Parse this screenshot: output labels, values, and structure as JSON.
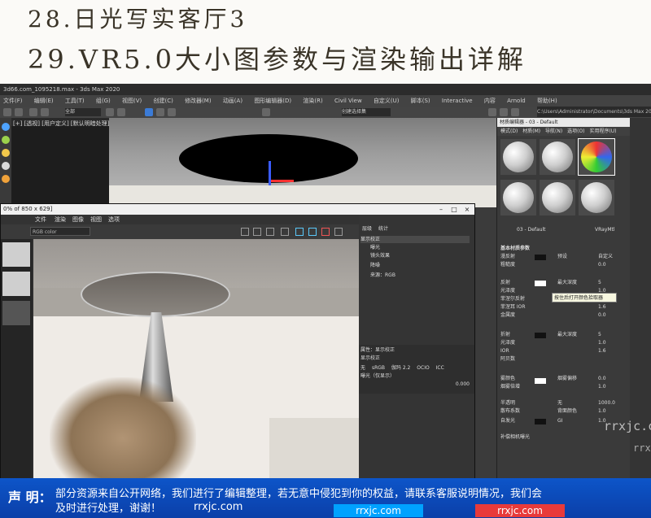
{
  "header": {
    "line1": "28.日光写实客厅3",
    "line2": "29.VR5.0大小图参数与渲染输出详解"
  },
  "max": {
    "title": "3d66.com_1095218.max - 3ds Max 2020",
    "menu": [
      "文件(F)",
      "编辑(E)",
      "工具(T)",
      "组(G)",
      "视图(V)",
      "创建(C)",
      "修改器(M)",
      "动画(A)",
      "图形编辑器(D)",
      "渲染(R)",
      "Civil View",
      "自定义(U)",
      "脚本(S)",
      "Interactive",
      "内容",
      "Arnold",
      "帮助(H)"
    ],
    "path": "C:\\Users\\Administrator\\Documents\\3ds Max 2020",
    "viewport_label": "[+] [透视] [用户定义] [默认明暗处理]",
    "viewport_colors": {
      "background": "#2a2a2a",
      "table": "#000000",
      "gizmo_blue": "#3a5cff",
      "gizmo_red": "#ff3030"
    },
    "selection_set": "创建选择集",
    "all_label": "全部"
  },
  "framebuffer": {
    "title": "0% of 850 x 629]",
    "menu": [
      "文件",
      "渲染",
      "图像",
      "视图",
      "选项"
    ],
    "color_select": "RGB color",
    "layer_tabs": [
      "层级",
      "统计"
    ],
    "layers": [
      "显示校正",
      "曝光",
      "镜头效果",
      "降噪",
      "来源：RGB"
    ],
    "props_title": "属性：显示校正",
    "props_sub": "显示校正",
    "colorspace": [
      "无",
      "sRGB",
      "伽玛 2.2",
      "OCIO",
      "ICC"
    ],
    "exposure_label": "曝光（仅显示）",
    "exposure_value": "0.000"
  },
  "material_editor": {
    "title": "材质编辑器 - 03 - Default",
    "menu": [
      "模式(D)",
      "材质(M)",
      "导航(N)",
      "选项(O)",
      "实用程序(U)"
    ],
    "material_name": "03 - Default",
    "material_type": "VRayMtl",
    "section": "基本材质参数",
    "rows": [
      {
        "label": "漫反射",
        "extra": "预设",
        "value": "自定义"
      },
      {
        "label": "粗糙度",
        "value": "0.0"
      },
      {
        "label": "反射",
        "extra": "最大深度",
        "value": "5"
      },
      {
        "label": "光泽度",
        "value": "1.0"
      },
      {
        "label": "菲涅尔反射",
        "value": ""
      },
      {
        "label": "菲涅耳 IOR",
        "value": "1.6"
      },
      {
        "label": "金属度",
        "value": "0.0"
      },
      {
        "label": "折射",
        "extra": "最大深度",
        "value": "5"
      },
      {
        "label": "光泽度",
        "value": "1.0"
      },
      {
        "label": "IOR",
        "value": "1.6"
      },
      {
        "label": "阿贝数",
        "value": ""
      },
      {
        "label": "雾颜色",
        "extra": "烟雾偏移",
        "value": "0.0"
      },
      {
        "label": "烟雾倍增",
        "value": "1.0"
      },
      {
        "label": "半透明",
        "extra": "无",
        "value": "1000.0"
      },
      {
        "label": "散布系数",
        "extra": "背面颜色",
        "value": "1.0"
      },
      {
        "label": "自发光",
        "extra": "GI",
        "value": "1.0"
      }
    ],
    "tooltip": "按住后打开颜色拾取器",
    "affect_channels": "补偿相机曝光",
    "diffuse_color": "#111111",
    "reflect_color": "#ffffff"
  },
  "watermarks": {
    "vertical1": "rrxjc.com",
    "vertical2": "rrxjc.com"
  },
  "disclaimer": {
    "title": "声 明：",
    "line1": "部分资源来自公开网络，我们进行了编辑整理，若无意中侵犯到你的权益，请联系客服说明情况，我们会",
    "line2": "及时进行处理，谢谢！",
    "site1": "rrxjc.com",
    "site2": "rrxjc.com",
    "site3": "rrxjc.com",
    "banner_color": "#0d55c9"
  }
}
